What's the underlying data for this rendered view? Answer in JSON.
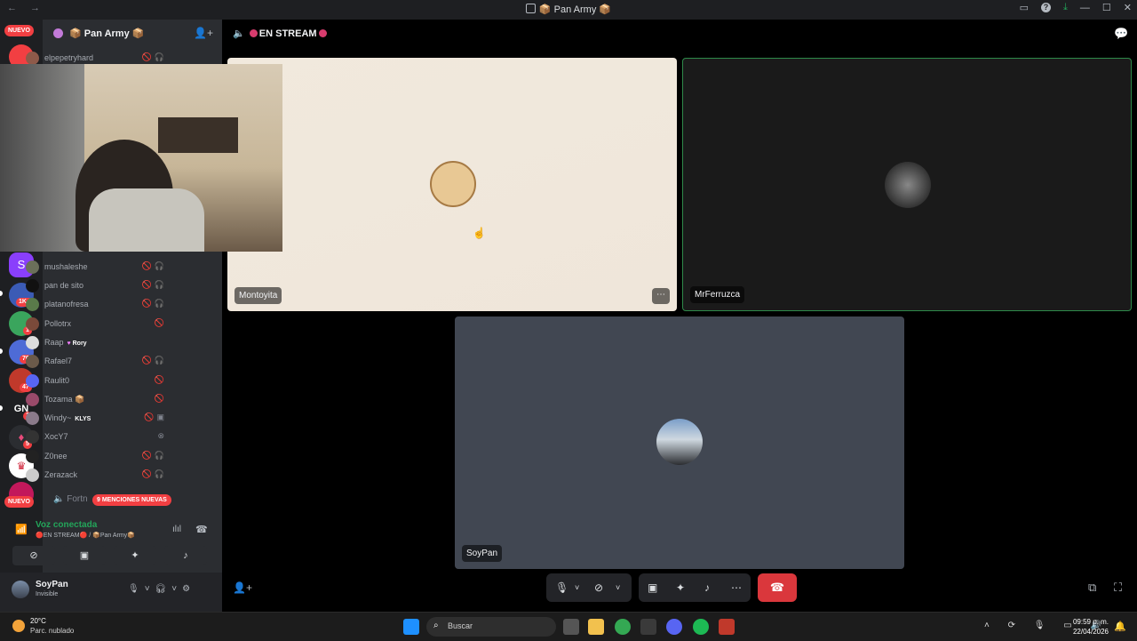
{
  "window": {
    "title": "📦 Pan Army 📦",
    "nav_arrows": "← →"
  },
  "guild_sidebar": {
    "nuevo_top": "NUEVO",
    "nuevo_bottom": "NUEVO",
    "badges": [
      "1K+",
      "1",
      "76",
      "47",
      "1",
      "5"
    ],
    "gn_label": "GN"
  },
  "server": {
    "name": "📦 Pan Army 📦"
  },
  "members": [
    {
      "name": "elpepetryhard",
      "icons": "🚫🎧"
    },
    {
      "name": "mushaleshe",
      "icons": "🚫🎧"
    },
    {
      "name": "pan de sito",
      "icons": "🚫🎧"
    },
    {
      "name": "platanofresa",
      "icons": "🚫🎧"
    },
    {
      "name": "Pollotrx",
      "icons": "🚫"
    },
    {
      "name": "Raap",
      "tag": "Rory",
      "icons": ""
    },
    {
      "name": "Rafael7",
      "icons": "🚫🎧"
    },
    {
      "name": "Raulit0",
      "icons": "🚫"
    },
    {
      "name": "Tozama 📦",
      "icons": "🚫"
    },
    {
      "name": "Windy~",
      "tag": "KLYS",
      "icons": "🚫▣"
    },
    {
      "name": "XocY7",
      "icons": "⊗"
    },
    {
      "name": "Z0nee",
      "icons": "🚫🎧"
    },
    {
      "name": "Zerazack",
      "icons": "🚫🎧"
    }
  ],
  "channel_partial": "Fortn",
  "mentions_badge": "9 MENCIONES NUEVAS",
  "voice": {
    "status": "Voz conectada",
    "location": "🔴EN STREAM🔴 / 📦Pan Army📦"
  },
  "user": {
    "name": "SoyPan",
    "status": "Invisible"
  },
  "stage": {
    "channel_title": "EN STREAM",
    "tiles": [
      {
        "name": "Montoyita"
      },
      {
        "name": "MrFerruzca"
      },
      {
        "name": "SoyPan"
      }
    ]
  },
  "taskbar": {
    "temp": "20°C",
    "weather": "Parc. nublado",
    "search_placeholder": "Buscar",
    "time": "09:59 p. m.",
    "date": "22/04/2026"
  },
  "colors": {
    "accent_green": "#23a55a",
    "hangup_red": "#da373c",
    "badge_red": "#f23f42"
  }
}
